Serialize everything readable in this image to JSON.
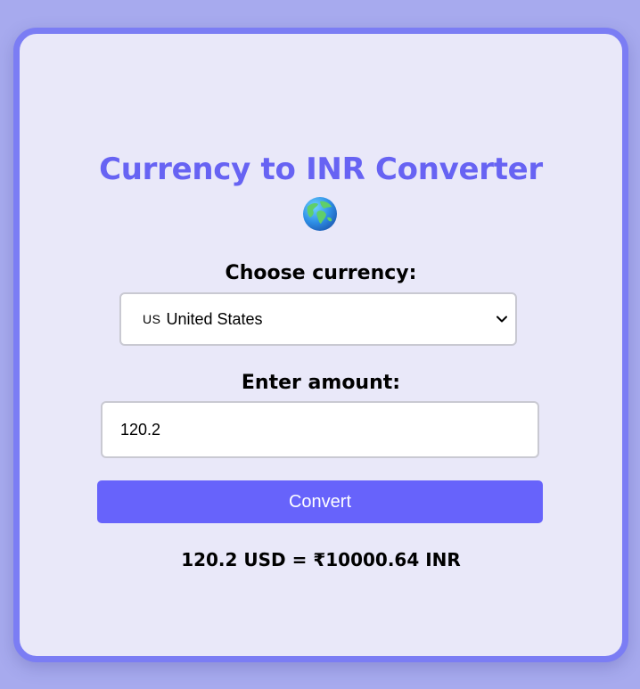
{
  "header": {
    "title": "Currency to INR Converter",
    "icon": "globe-icon"
  },
  "currency": {
    "label": "Choose currency:",
    "selected_flag": "US",
    "selected_name": "United States"
  },
  "amount": {
    "label": "Enter amount:",
    "value": "120.2"
  },
  "convert": {
    "button_label": "Convert"
  },
  "result": {
    "text": "120.2 USD = ₹10000.64 INR"
  },
  "colors": {
    "accent": "#6763f3",
    "button": "#6763fb",
    "card_border": "#7b7df4",
    "card_bg": "#e9e8f9",
    "page_bg": "#a7aaee"
  }
}
